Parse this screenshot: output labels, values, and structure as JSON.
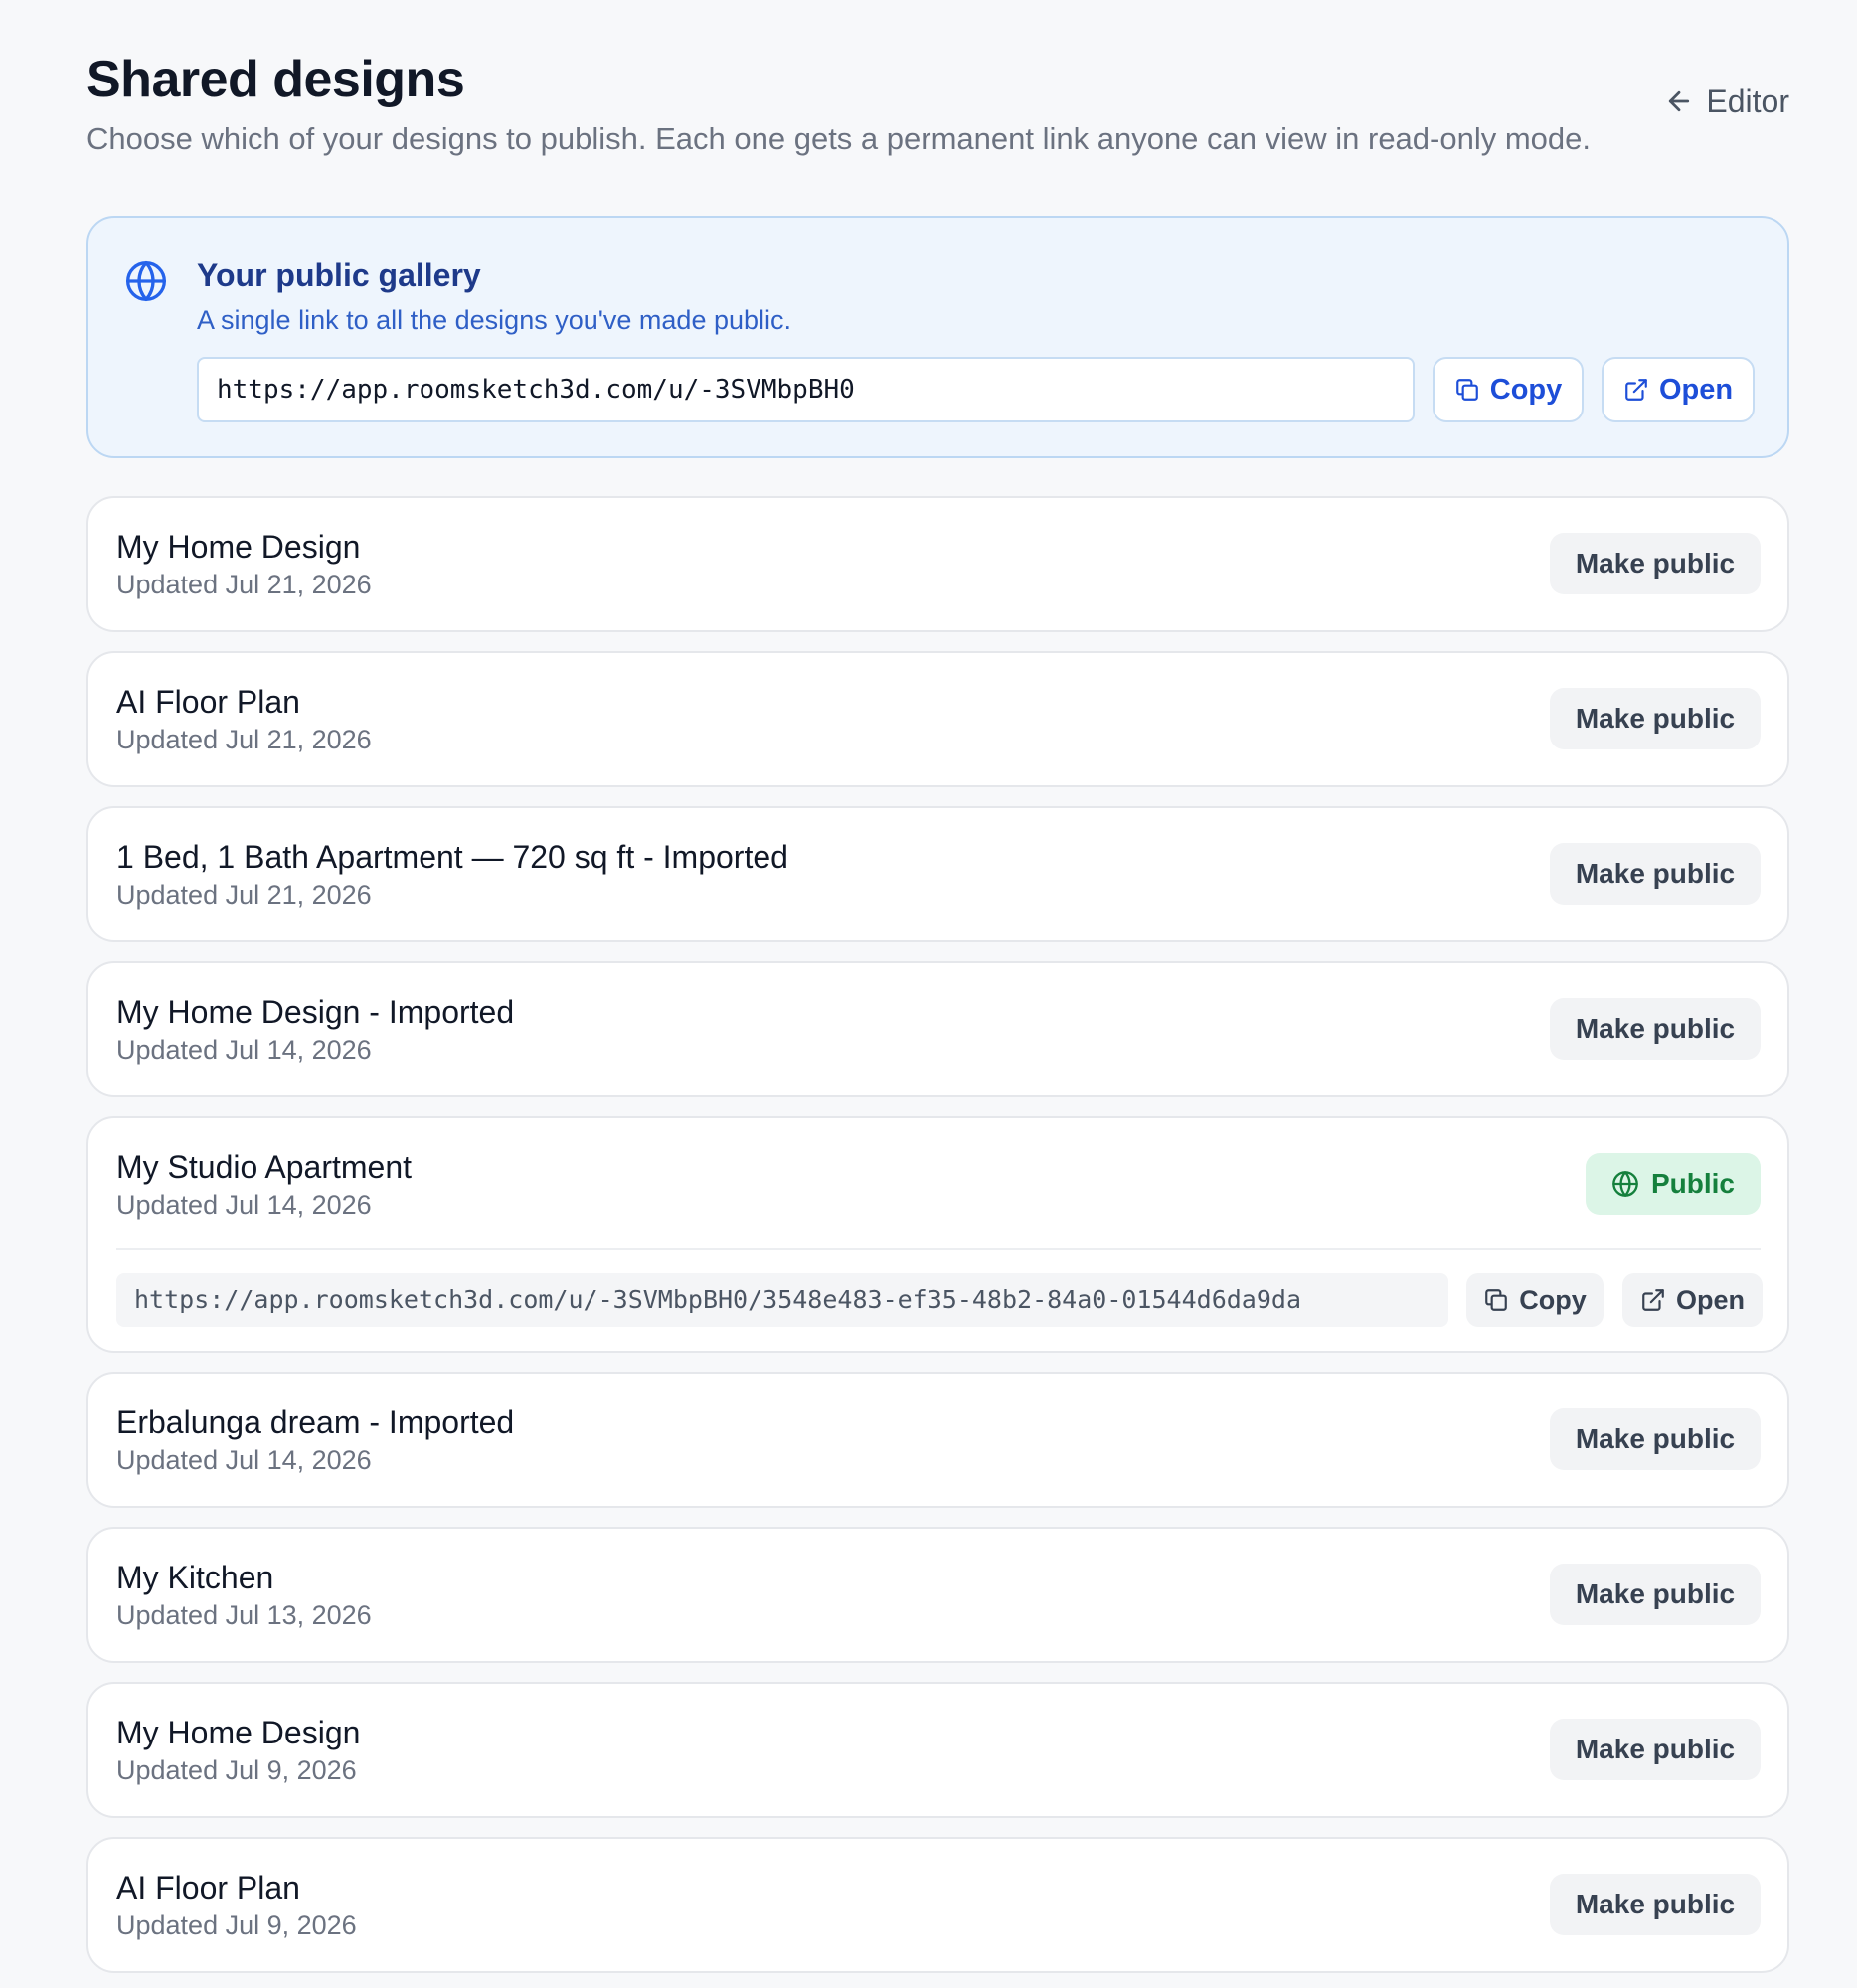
{
  "header": {
    "title": "Shared designs",
    "subtitle": "Choose which of your designs to publish. Each one gets a permanent link anyone can view in read-only mode.",
    "back_label": "Editor",
    "back_icon": "arrow-left-icon"
  },
  "gallery": {
    "icon": "globe-icon",
    "title": "Your public gallery",
    "description": "A single link to all the designs you've made public.",
    "url": "https://app.roomsketch3d.com/u/-3SVMbpBH0",
    "copy_label": "Copy",
    "open_label": "Open"
  },
  "designs": [
    {
      "name": "My Home Design",
      "updated": "Updated Jul 21, 2026",
      "action": "Make public"
    },
    {
      "name": "AI Floor Plan",
      "updated": "Updated Jul 21, 2026",
      "action": "Make public"
    },
    {
      "name": "1 Bed, 1 Bath Apartment — 720 sq ft - Imported",
      "updated": "Updated Jul 21, 2026",
      "action": "Make public"
    },
    {
      "name": "My Home Design - Imported",
      "updated": "Updated Jul 14, 2026",
      "action": "Make public"
    },
    {
      "name": "My Studio Apartment",
      "updated": "Updated Jul 14, 2026",
      "status": "Public",
      "link": "https://app.roomsketch3d.com/u/-3SVMbpBH0/3548e483-ef35-48b2-84a0-01544d6da9da",
      "copy_label": "Copy",
      "open_label": "Open"
    },
    {
      "name": "Erbalunga dream - Imported",
      "updated": "Updated Jul 14, 2026",
      "action": "Make public"
    },
    {
      "name": "My Kitchen",
      "updated": "Updated Jul 13, 2026",
      "action": "Make public"
    },
    {
      "name": "My Home Design",
      "updated": "Updated Jul 9, 2026",
      "action": "Make public"
    },
    {
      "name": "AI Floor Plan",
      "updated": "Updated Jul 9, 2026",
      "action": "Make public"
    }
  ],
  "colors": {
    "background": "#f7f8fa",
    "gallery_bg": "#eef5fd",
    "gallery_accent": "#1d4ed8",
    "public_badge_bg": "#dcf5e7",
    "public_badge_text": "#15803d"
  }
}
